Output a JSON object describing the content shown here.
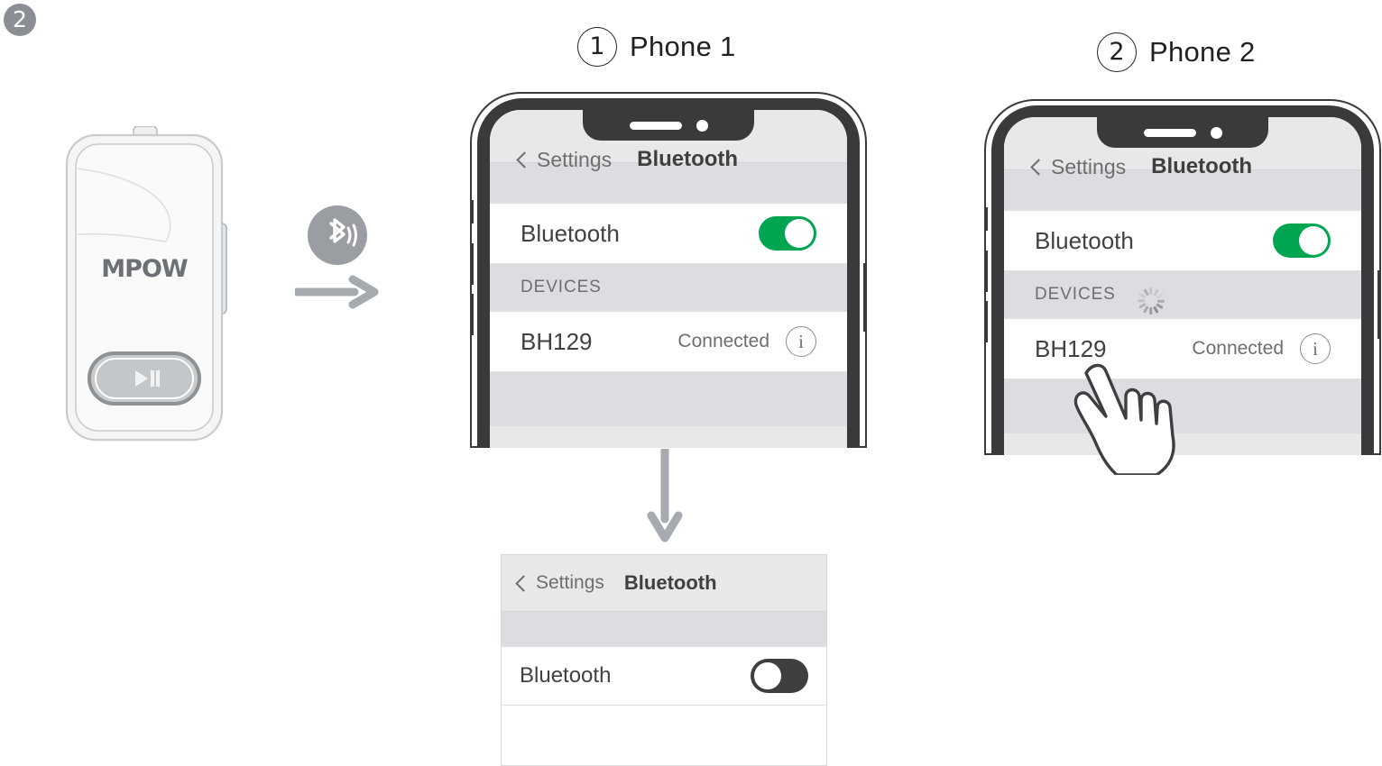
{
  "step": {
    "number": "2"
  },
  "device": {
    "brand": "MPOW",
    "play_button_icon": "play-pause-icon"
  },
  "transfer": {
    "bluetooth_icon": "bluetooth-icon",
    "arrow_right_icon": "arrow-right-icon",
    "arrow_down_icon": "arrow-down-icon"
  },
  "phones": [
    {
      "caption_number": "1",
      "caption_label": "Phone 1",
      "screen": {
        "back_label": "Settings",
        "title": "Bluetooth",
        "toggle_row_label": "Bluetooth",
        "toggle_state": "on",
        "section_header": "DEVICES",
        "has_spinner": false,
        "device_name": "BH129",
        "device_status": "Connected",
        "info_icon": "info-icon"
      }
    },
    {
      "caption_number": "2",
      "caption_label": "Phone 2",
      "screen": {
        "back_label": "Settings",
        "title": "Bluetooth",
        "toggle_row_label": "Bluetooth",
        "toggle_state": "on",
        "section_header": "DEVICES",
        "has_spinner": true,
        "device_name": "BH129",
        "device_status": "Connected",
        "info_icon": "info-icon"
      }
    }
  ],
  "result_panel": {
    "back_label": "Settings",
    "title": "Bluetooth",
    "toggle_row_label": "Bluetooth",
    "toggle_state": "off"
  },
  "cursor": {
    "icon": "pointing-hand-icon"
  },
  "colors": {
    "toggle_on": "#00a551",
    "toggle_off": "#3f3f41",
    "bezel": "#3a3a3c",
    "screen_gray": "#dbdde0",
    "accent_gray": "#8b8e92",
    "text_dark": "#231f20"
  }
}
